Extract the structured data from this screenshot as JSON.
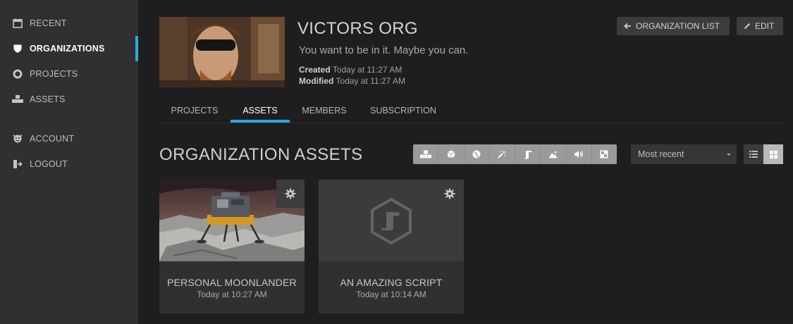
{
  "sidebar": {
    "items": [
      {
        "label": "RECENT",
        "icon": "calendar-icon"
      },
      {
        "label": "ORGANIZATIONS",
        "icon": "shield-icon",
        "active": true
      },
      {
        "label": "PROJECTS",
        "icon": "circle-icon"
      },
      {
        "label": "ASSETS",
        "icon": "assets-icon"
      },
      {
        "label": "ACCOUNT",
        "icon": "account-icon"
      },
      {
        "label": "LOGOUT",
        "icon": "logout-icon"
      }
    ]
  },
  "header": {
    "title": "VICTORS ORG",
    "subtitle": "You want to be in it. Maybe you can.",
    "created_label": "Created",
    "created_value": "Today at 11:27 AM",
    "modified_label": "Modified",
    "modified_value": "Today at 11:27 AM",
    "org_list_label": "ORGANIZATION LIST",
    "edit_label": "EDIT"
  },
  "tabs": [
    {
      "label": "PROJECTS"
    },
    {
      "label": "ASSETS",
      "active": true
    },
    {
      "label": "MEMBERS"
    },
    {
      "label": "SUBSCRIPTION"
    }
  ],
  "section": {
    "title": "ORGANIZATION ASSETS"
  },
  "filters": [
    "all-assets-icon",
    "model-icon",
    "material-icon",
    "effect-icon",
    "script-icon",
    "terrain-icon",
    "audio-icon",
    "texture-icon"
  ],
  "sort": {
    "selected": "Most recent"
  },
  "view": {
    "active": "grid"
  },
  "assets": [
    {
      "title": "PERSONAL MOONLANDER",
      "date": "Today at 10:27 AM"
    },
    {
      "title": "AN AMAZING SCRIPT",
      "date": "Today at 10:14 AM"
    }
  ],
  "colors": {
    "accent": "#29a9e0",
    "sidebar": "#303030",
    "background": "#1e1e1e"
  }
}
